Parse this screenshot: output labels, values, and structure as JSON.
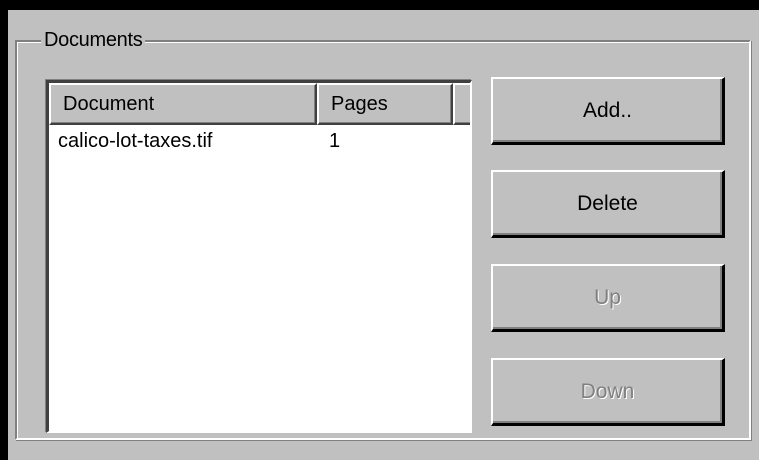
{
  "group": {
    "title": "Documents"
  },
  "list": {
    "columns": [
      "Document",
      "Pages"
    ],
    "rows": [
      {
        "document": "calico-lot-taxes.tif",
        "pages": "1"
      }
    ]
  },
  "buttons": {
    "add": {
      "label": "Add..",
      "enabled": true
    },
    "delete": {
      "label": "Delete",
      "enabled": true
    },
    "up": {
      "label": "Up",
      "enabled": false
    },
    "down": {
      "label": "Down",
      "enabled": false
    }
  }
}
